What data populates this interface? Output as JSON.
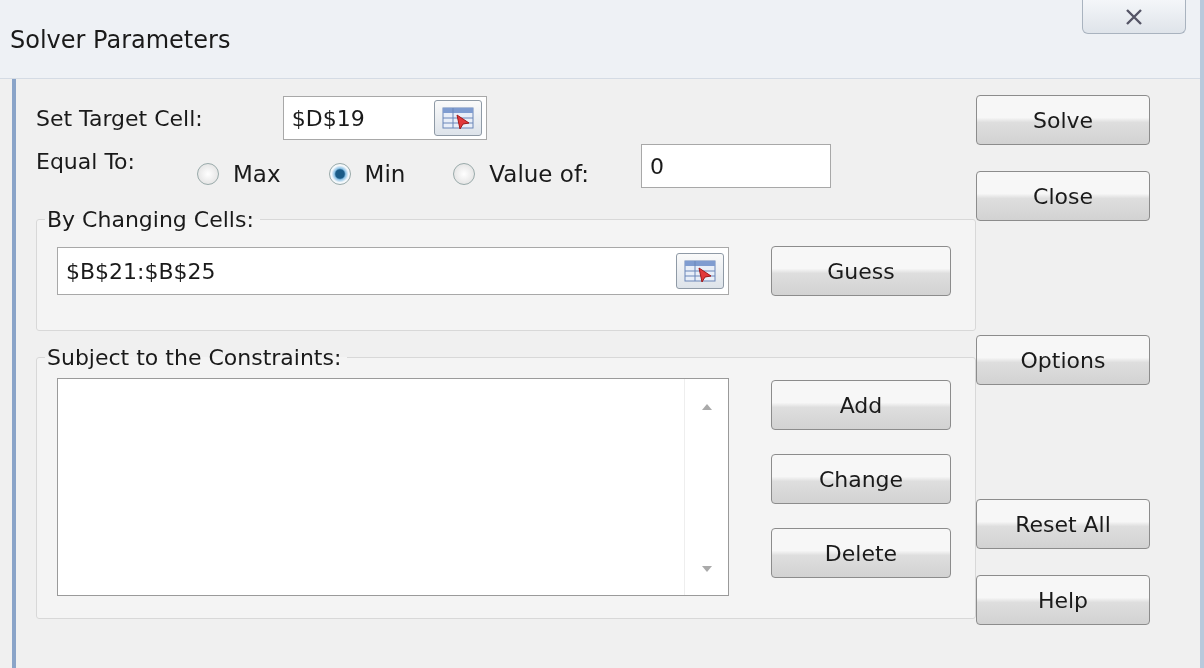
{
  "window": {
    "title": "Solver Parameters"
  },
  "target_cell": {
    "label": "Set Target Cell:",
    "value": "$D$19"
  },
  "equal_to": {
    "label": "Equal To:",
    "options": [
      {
        "label": "Max",
        "selected": false
      },
      {
        "label": "Min",
        "selected": true
      },
      {
        "label": "Value of:",
        "selected": false
      }
    ],
    "value": "0"
  },
  "changing_cells": {
    "label": "By Changing Cells:",
    "value": "$B$21:$B$25",
    "button": "Guess"
  },
  "constraints": {
    "label": "Subject to the Constraints:",
    "buttons": [
      "Add",
      "Change",
      "Delete"
    ]
  },
  "side_buttons": [
    "Solve",
    "Close",
    "Options",
    "Reset All",
    "Help"
  ]
}
